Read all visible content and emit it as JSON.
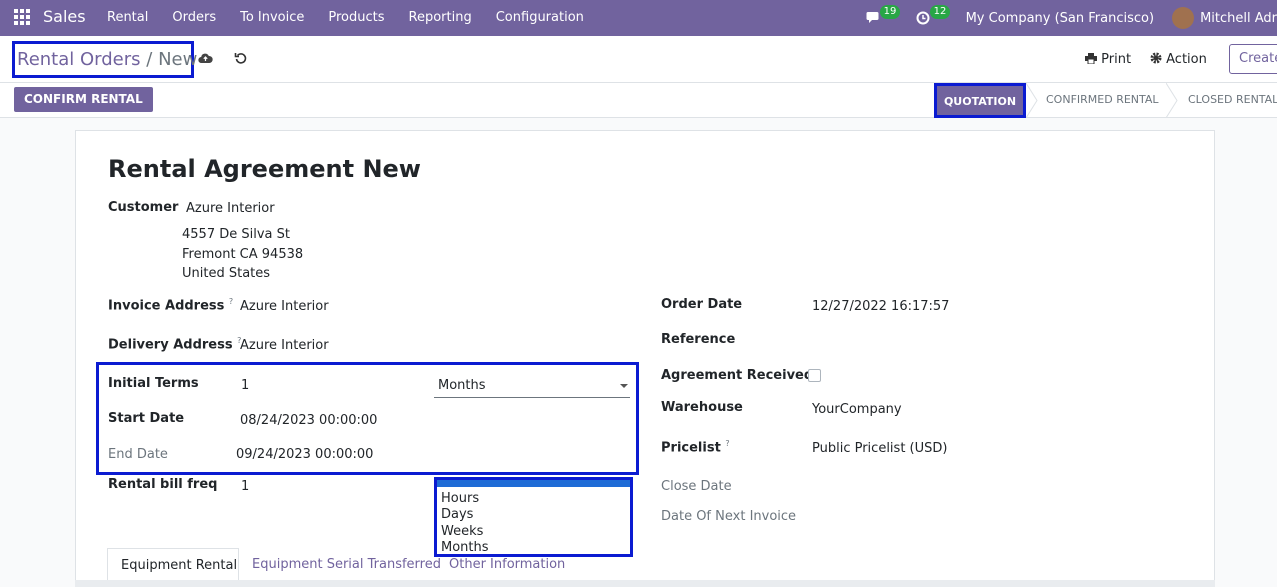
{
  "navbar": {
    "app_name": "Sales",
    "menu": [
      "Rental",
      "Orders",
      "To Invoice",
      "Products",
      "Reporting",
      "Configuration"
    ],
    "messages_count": "19",
    "activities_count": "12",
    "company": "My Company (San Francisco)",
    "user": "Mitchell Adr"
  },
  "control": {
    "breadcrumb_parent": "Rental Orders",
    "breadcrumb_sep": "/",
    "breadcrumb_current": "New",
    "print_label": "Print",
    "action_label": "Action",
    "create_label": "Create"
  },
  "statusbar": {
    "confirm_label": "CONFIRM RENTAL",
    "stages": [
      "QUOTATION",
      "CONFIRMED RENTAL",
      "CLOSED RENTAL"
    ]
  },
  "form": {
    "title": "Rental Agreement New",
    "customer_label": "Customer",
    "customer_name": "Azure Interior",
    "address_line1": "4557 De Silva St",
    "address_line2": "Fremont CA 94538",
    "address_line3": "United States",
    "invoice_address_label": "Invoice Address",
    "invoice_address": "Azure Interior",
    "delivery_address_label": "Delivery Address",
    "delivery_address": "Azure Interior",
    "help_mark": "?",
    "initial_terms_label": "Initial Terms",
    "initial_terms_value": "1",
    "initial_terms_unit": "Months",
    "start_date_label": "Start Date",
    "start_date": "08/24/2023 00:00:00",
    "end_date_label": "End Date",
    "end_date": "09/24/2023 00:00:00",
    "bill_freq_label": "Rental bill freq",
    "bill_freq_value": "1",
    "order_date_label": "Order Date",
    "order_date": "12/27/2022 16:17:57",
    "reference_label": "Reference",
    "agreement_label": "Agreement Received?",
    "warehouse_label": "Warehouse",
    "warehouse": "YourCompany",
    "pricelist_label": "Pricelist",
    "pricelist": "Public Pricelist (USD)",
    "close_date_label": "Close Date",
    "next_invoice_label": "Date Of Next Invoice"
  },
  "dropdown": {
    "options": [
      "Hours",
      "Days",
      "Weeks",
      "Months"
    ]
  },
  "tabs": [
    "Equipment Rental",
    "Equipment Serial Transferred",
    "Other Information"
  ],
  "colors": {
    "brand": "#71639e",
    "highlight": "#0b1bd1"
  }
}
